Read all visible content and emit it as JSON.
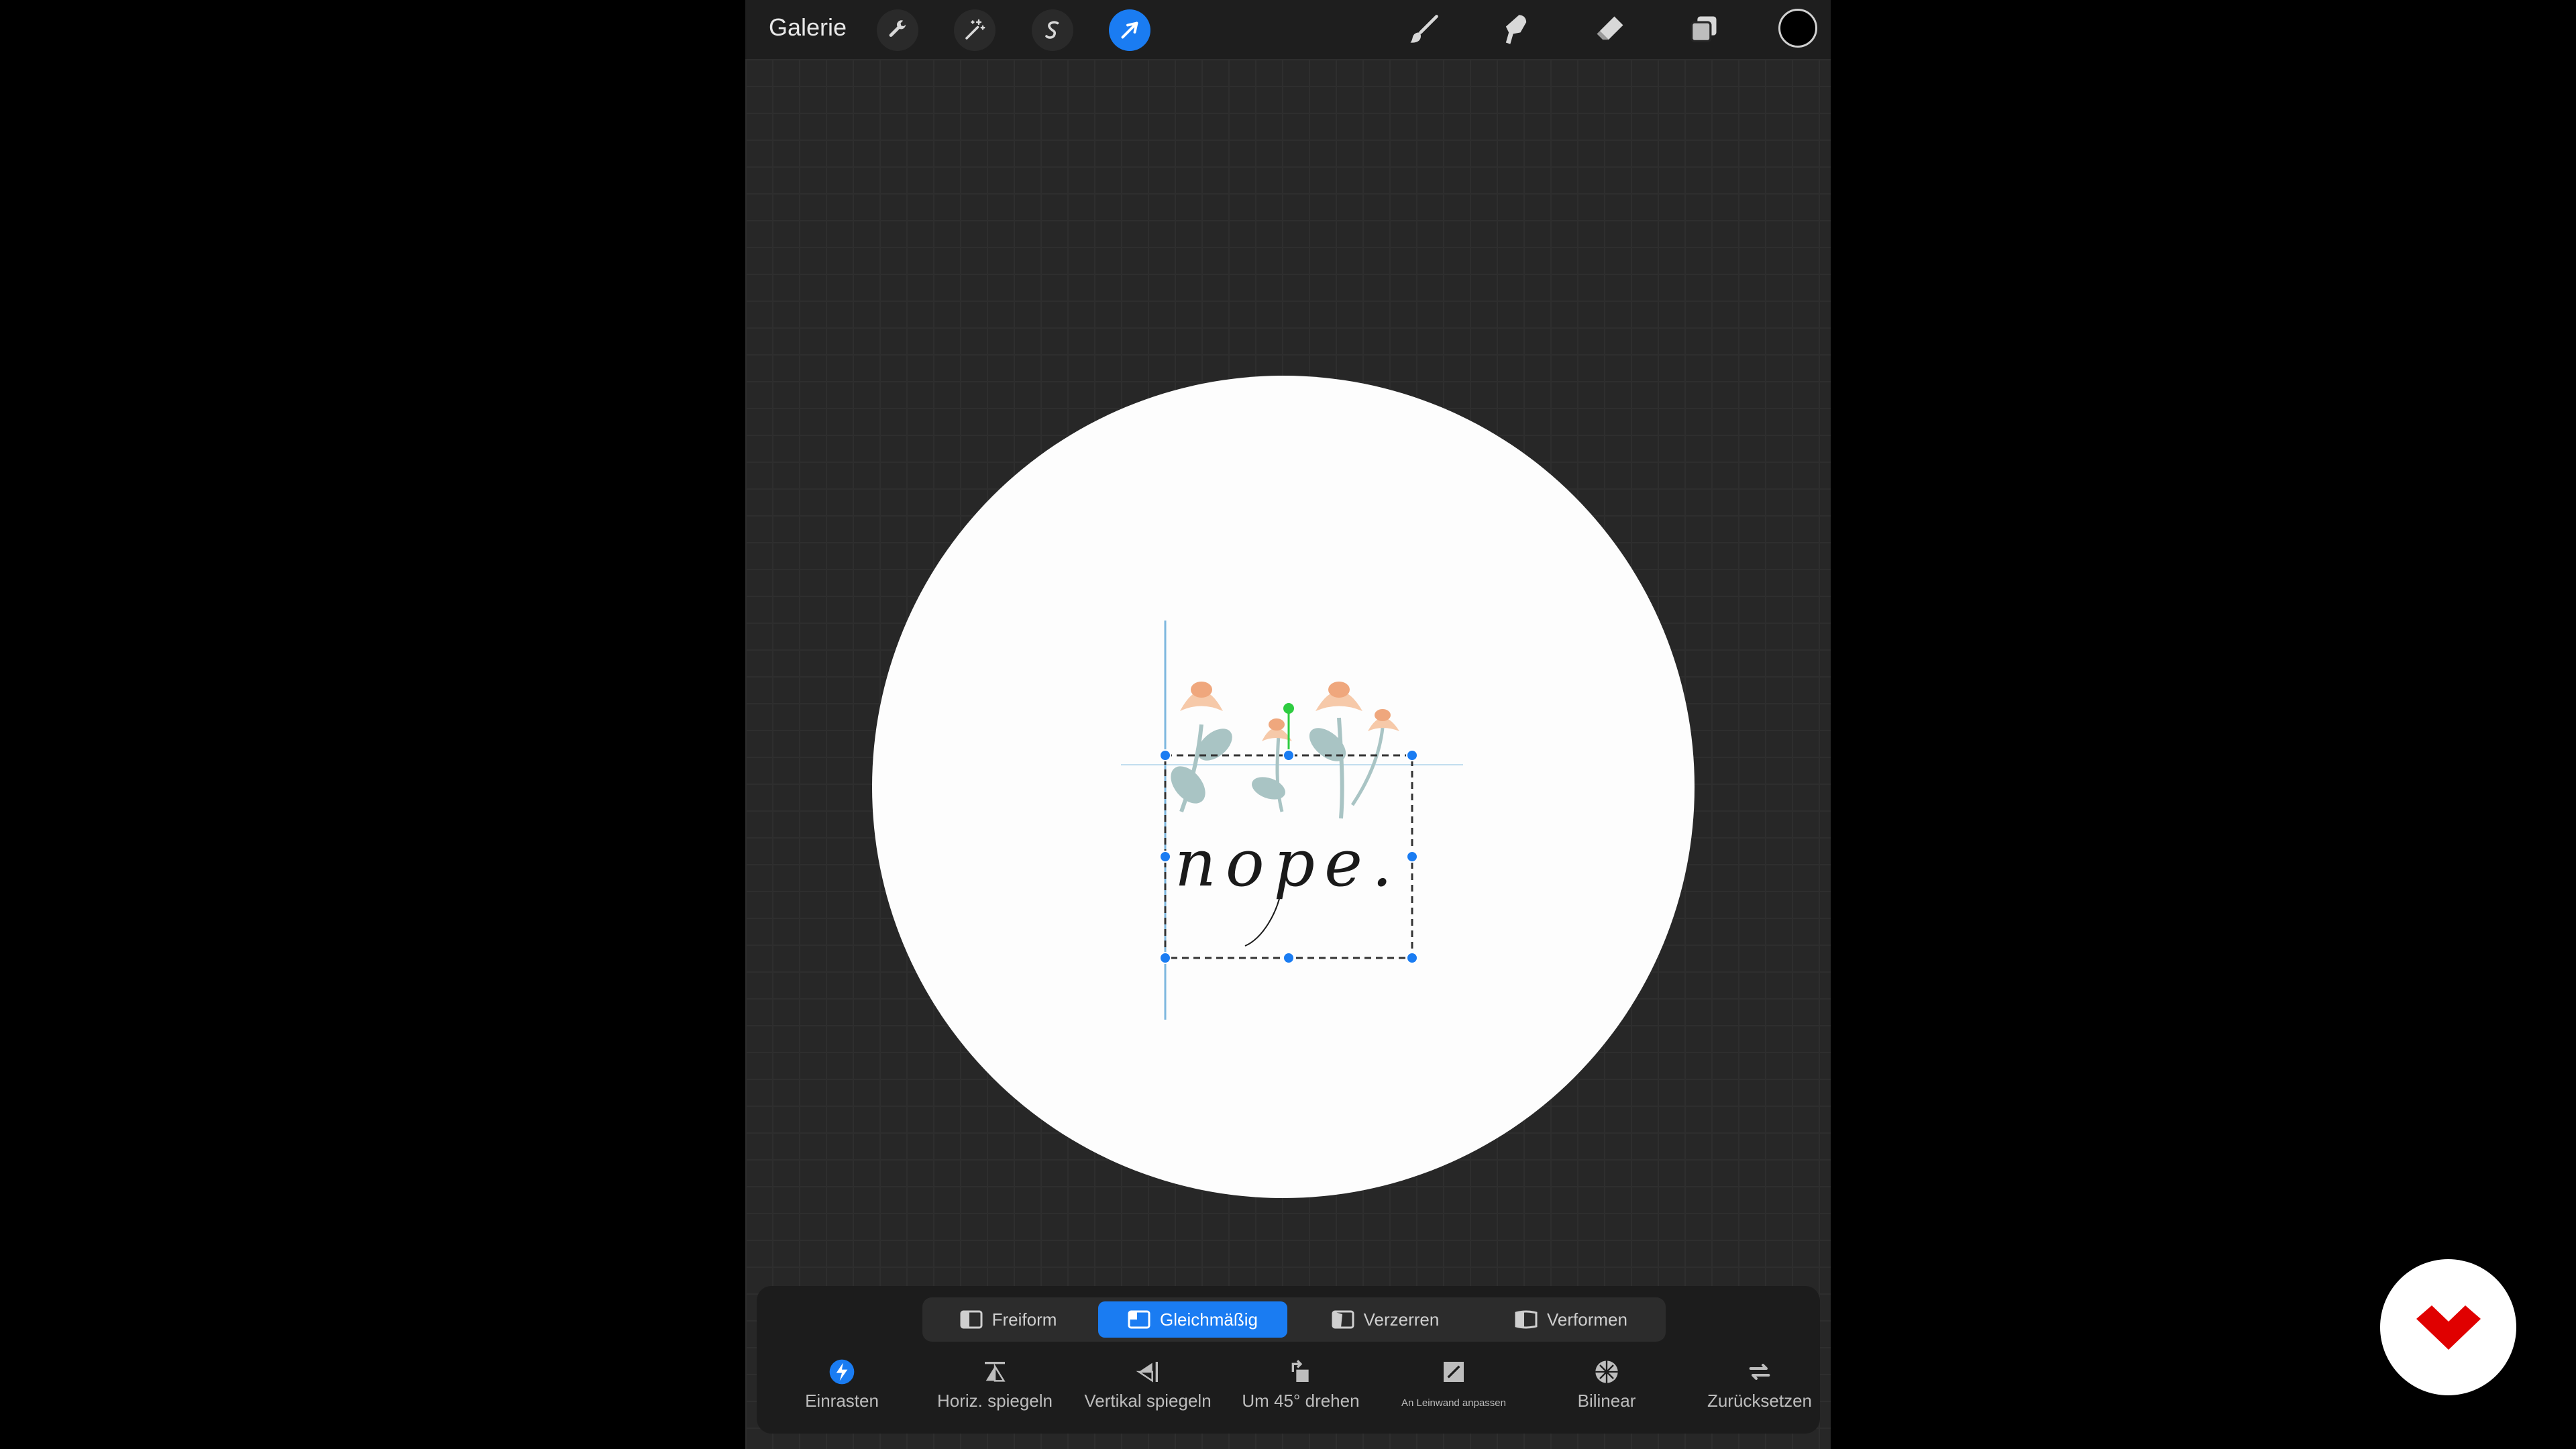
{
  "topbar": {
    "gallery_label": "Galerie",
    "icons": [
      "wrench-icon",
      "magic-wand-icon",
      "selection-icon",
      "transform-arrow-icon"
    ],
    "tools": [
      "brush-icon",
      "smudge-icon",
      "eraser-icon",
      "layers-icon"
    ],
    "current_color": "#000000"
  },
  "artwork": {
    "text": "nope."
  },
  "transform_modes": {
    "items": [
      {
        "label": "Freiform",
        "active": false
      },
      {
        "label": "Gleichmäßig",
        "active": true
      },
      {
        "label": "Verzerren",
        "active": false
      },
      {
        "label": "Verformen",
        "active": false
      }
    ]
  },
  "actions": {
    "items": [
      {
        "label": "Einrasten",
        "icon": "snap-icon"
      },
      {
        "label": "Horiz. spiegeln",
        "icon": "flip-horizontal-icon"
      },
      {
        "label": "Vertikal spiegeln",
        "icon": "flip-vertical-icon"
      },
      {
        "label": "Um 45° drehen",
        "icon": "rotate-icon"
      },
      {
        "label": "An Leinwand anpassen",
        "icon": "fit-canvas-icon"
      },
      {
        "label": "Bilinear",
        "icon": "interpolation-icon"
      },
      {
        "label": "Zurücksetzen",
        "icon": "reset-icon"
      }
    ]
  },
  "colors": {
    "accent": "#1a7cf2",
    "snap_guide": "#5fa8d8",
    "rotation_handle": "#2ecc40"
  },
  "logo_icon": "brand-logo-icon"
}
